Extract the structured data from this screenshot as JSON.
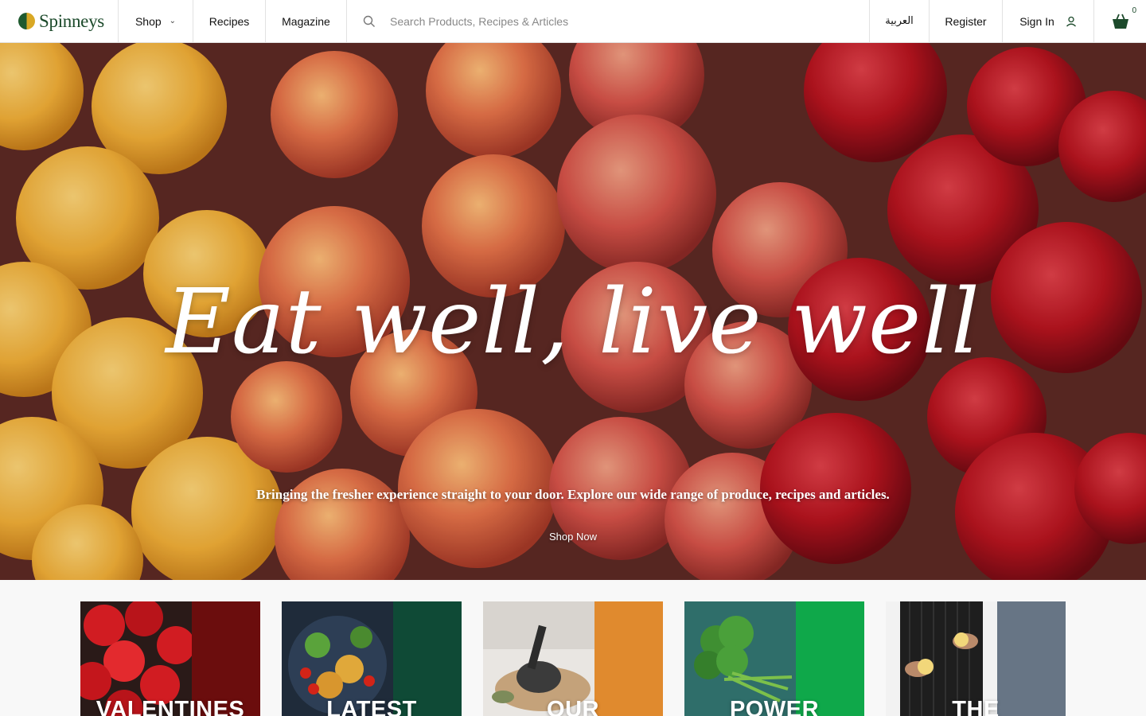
{
  "brand": {
    "name": "Spinneys"
  },
  "nav": {
    "shop": "Shop",
    "recipes": "Recipes",
    "magazine": "Magazine",
    "language": "العربية",
    "register": "Register",
    "sign_in": "Sign In"
  },
  "search": {
    "placeholder": "Search Products, Recipes & Articles"
  },
  "basket": {
    "count": "0"
  },
  "hero": {
    "title": "Eat well, live well",
    "subtitle": "Bringing the fresher experience straight to your door. Explore our wide range of produce, recipes and articles.",
    "cta": "Shop Now"
  },
  "cards": [
    {
      "label": "VALENTINES",
      "band_color": "#6b0d0d"
    },
    {
      "label": "LATEST",
      "band_color": "#0f4a36"
    },
    {
      "label": "OUR",
      "band_color": "#e08a2e"
    },
    {
      "label": "POWER",
      "band_color": "#0fa84a"
    },
    {
      "label": "THE",
      "band_color": "#677585"
    }
  ]
}
